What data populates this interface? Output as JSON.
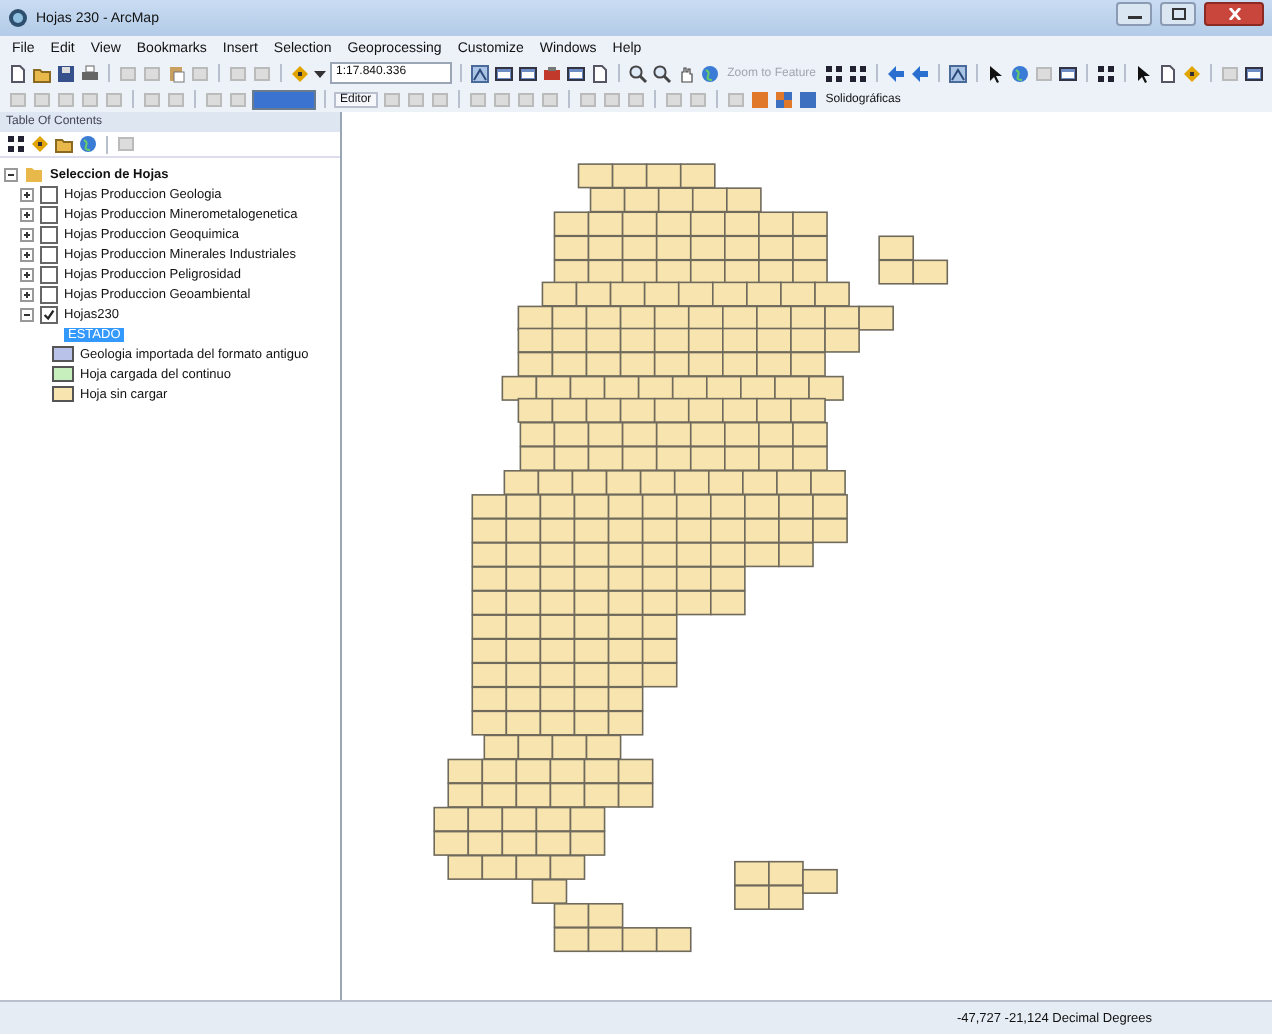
{
  "window": {
    "title": "Hojas 230 - ArcMap"
  },
  "menu": [
    "File",
    "Edit",
    "View",
    "Bookmarks",
    "Insert",
    "Selection",
    "Geoprocessing",
    "Customize",
    "Windows",
    "Help"
  ],
  "toolbar": {
    "scale": "1:17.840.336",
    "zoom_to_feature": {
      "label": "Zoom to Feature",
      "disabled": true
    },
    "editor": "Editor",
    "layer_dropdown": "Solidográficas"
  },
  "toc": {
    "title": "Table Of Contents",
    "root": {
      "label": "Seleccion de Hojas",
      "expanded": true,
      "children": [
        {
          "label": "Hojas Produccion Geologia",
          "expanded": false,
          "checked": false
        },
        {
          "label": "Hojas Produccion Minerometalogenetica",
          "expanded": false,
          "checked": false
        },
        {
          "label": "Hojas Produccion Geoquimica",
          "expanded": false,
          "checked": false
        },
        {
          "label": "Hojas Produccion Minerales Industriales",
          "expanded": false,
          "checked": false
        },
        {
          "label": "Hojas Produccion Peligrosidad",
          "expanded": false,
          "checked": false
        },
        {
          "label": "Hojas Produccion Geoambiental",
          "expanded": false,
          "checked": false
        },
        {
          "label": "Hojas230",
          "expanded": true,
          "checked": true
        }
      ]
    },
    "legend": {
      "heading": "ESTADO",
      "selected": true,
      "items": [
        {
          "label": "Geologia importada del formato antiguo",
          "color": "#b9c3ea"
        },
        {
          "label": "Hoja cargada del continuo",
          "color": "#c6efbd"
        },
        {
          "label": "Hoja sin cargar",
          "color": "#f7e4ae"
        }
      ]
    }
  },
  "status_bar": {
    "coordinates": "-47,727  -21,124 Decimal Degrees"
  }
}
